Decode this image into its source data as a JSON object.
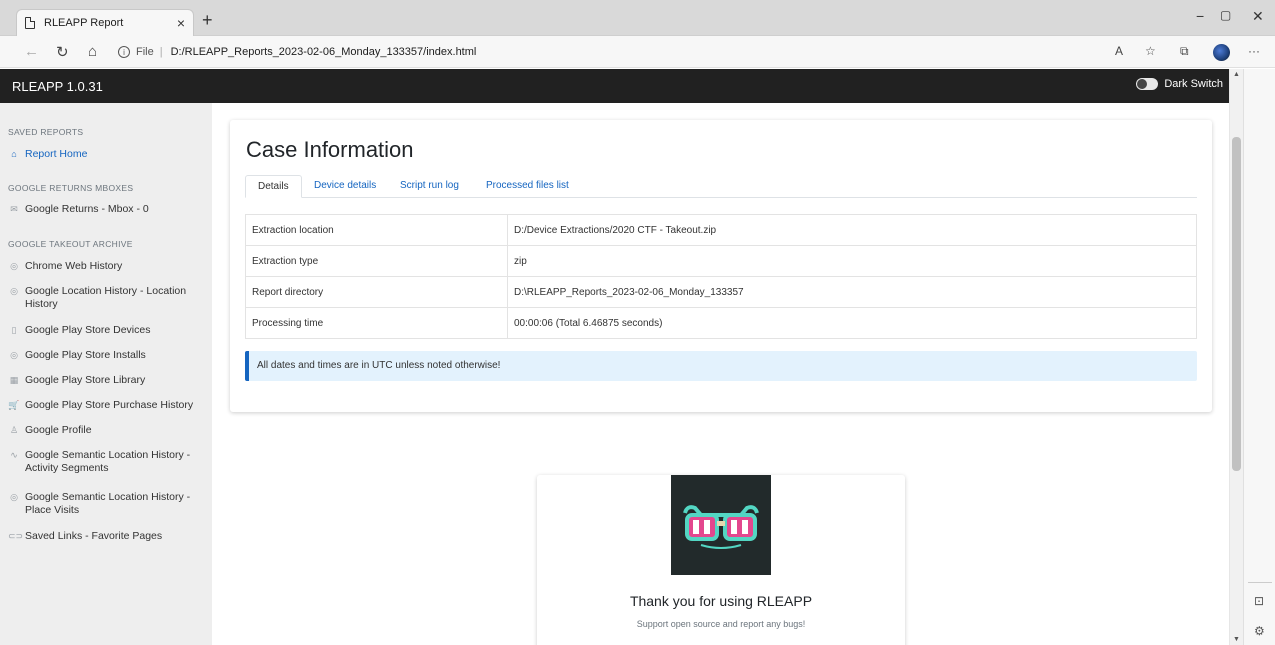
{
  "browser": {
    "tab_title": "RLEAPP Report",
    "tab_close": "×",
    "new_tab": "+",
    "address_scheme": "File",
    "address_separator": "|",
    "address_url": "D:/RLEAPP_Reports_2023-02-06_Monday_133357/index.html",
    "minimize": "−",
    "maximize": "▢",
    "close": "✕",
    "back": "←",
    "refresh": "↻",
    "home": "⌂",
    "read_aloud": "A",
    "favorites": "☆",
    "extensions": "⧉",
    "more": "···"
  },
  "navbar": {
    "brand": "RLEAPP 1.0.31",
    "dark_switch_label": "Dark Switch"
  },
  "sidebar": {
    "saved_reports_heading": "SAVED REPORTS",
    "report_home": "Report Home",
    "mboxes_heading": "GOOGLE RETURNS MBOXES",
    "mbox_item": "Google Returns - Mbox - 0",
    "takeout_heading": "GOOGLE TAKEOUT ARCHIVE",
    "items": [
      {
        "label": "Chrome Web History",
        "icon": "◎"
      },
      {
        "label": "Google Location History - Location History",
        "icon": "◎"
      },
      {
        "label": "Google Play Store Devices",
        "icon": "▯"
      },
      {
        "label": "Google Play Store Installs",
        "icon": "◎"
      },
      {
        "label": "Google Play Store Library",
        "icon": "▦"
      },
      {
        "label": "Google Play Store Purchase History",
        "icon": "🛒"
      },
      {
        "label": "Google Profile",
        "icon": "♙"
      },
      {
        "label": "Google Semantic Location History - Activity Segments",
        "icon": "∿"
      },
      {
        "label": "Google Semantic Location History - Place Visits",
        "icon": "◎"
      },
      {
        "label": "Saved Links - Favorite Pages",
        "icon": "⊂⊃"
      }
    ]
  },
  "case": {
    "title": "Case Information",
    "tabs": [
      "Details",
      "Device details",
      "Script run log",
      "Processed files list"
    ],
    "rows": [
      {
        "key": "Extraction location",
        "value": "D:/Device Extractions/2020 CTF - Takeout.zip"
      },
      {
        "key": "Extraction type",
        "value": "zip"
      },
      {
        "key": "Report directory",
        "value": "D:\\RLEAPP_Reports_2023-02-06_Monday_133357"
      },
      {
        "key": "Processing time",
        "value": "00:00:06 (Total 6.46875 seconds)"
      }
    ],
    "alert": "All dates and times are in UTC unless noted otherwise!"
  },
  "footer_card": {
    "thanks": "Thank you for using RLEAPP",
    "support": "Support open source and report any bugs!"
  },
  "colors": {
    "navbar": "#212121",
    "sidebar": "#eeeeee",
    "accent": "#1565c0",
    "alert_bg": "#e3f2fd"
  }
}
